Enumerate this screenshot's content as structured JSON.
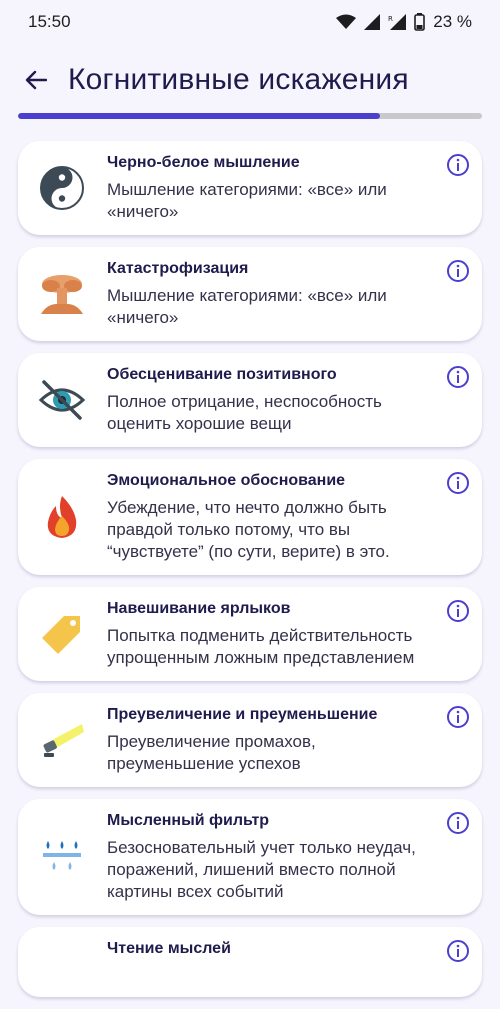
{
  "status": {
    "time": "15:50",
    "battery": "23 %"
  },
  "header": {
    "title": "Когнитивные искажения"
  },
  "progress": {
    "value": 0.78,
    "color": "#4b3fd0"
  },
  "items": [
    {
      "title": "Черно-белое мышление",
      "desc": "Мышление категориями: «все» или «ничего»",
      "icon": "yin-yang-icon"
    },
    {
      "title": "Катастрофизация",
      "desc": "Мышление категориями: «все» или «ничего»",
      "icon": "explosion-icon"
    },
    {
      "title": "Обесценивание позитивного",
      "desc": "Полное отрицание, неспособность оценить хорошие вещи",
      "icon": "eye-crossed-icon"
    },
    {
      "title": "Эмоциональное обоснование",
      "desc": "Убеждение, что нечто должно быть правдой только потому, что вы “чувствуете” (по сути, верите) в это.",
      "icon": "fire-icon"
    },
    {
      "title": "Навешивание ярлыков",
      "desc": "Попытка подменить действительность упрощенным ложным представлением",
      "icon": "tag-icon"
    },
    {
      "title": "Преувеличение и преуменьшение",
      "desc": "Преувеличение промахов, преуменьшение успехов",
      "icon": "flashlight-icon"
    },
    {
      "title": "Мысленный фильтр",
      "desc": "Безосновательный учет только неудач, поражений, лишений вместо полной картины всех событий",
      "icon": "filter-drops-icon"
    },
    {
      "title": "Чтение мыслей",
      "desc": "",
      "icon": "mind-icon"
    }
  ]
}
